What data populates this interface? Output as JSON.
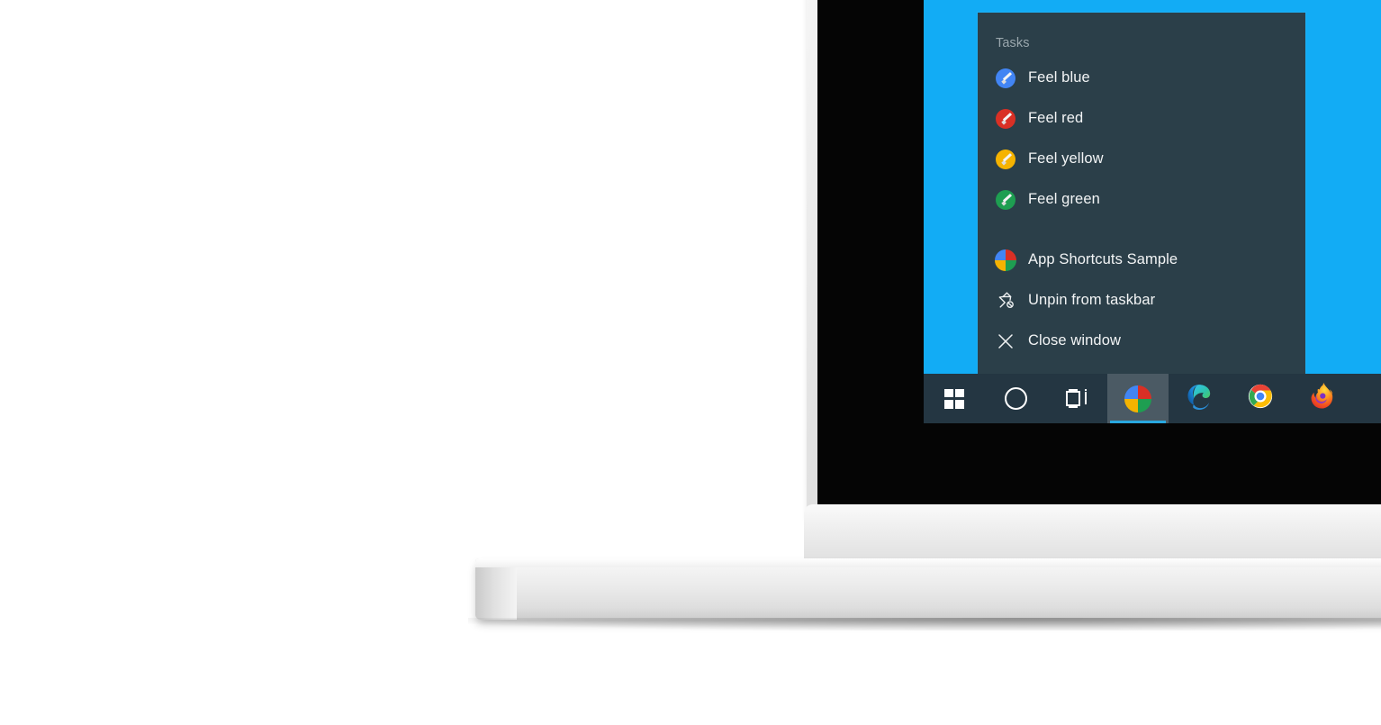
{
  "desktop": {
    "wallpaper_color": "#12acf5"
  },
  "jumplist": {
    "header": "Tasks",
    "background_color": "#2b3f49",
    "tasks": [
      {
        "label": "Feel blue",
        "icon": "pencil-circle-icon",
        "color": "#4285f4"
      },
      {
        "label": "Feel red",
        "icon": "pencil-circle-icon",
        "color": "#d93025"
      },
      {
        "label": "Feel yellow",
        "icon": "pencil-circle-icon",
        "color": "#f5b300"
      },
      {
        "label": "Feel green",
        "icon": "pencil-circle-icon",
        "color": "#1e9e51"
      }
    ],
    "actions": [
      {
        "label": "App Shortcuts Sample",
        "icon": "app-pie-icon"
      },
      {
        "label": "Unpin from taskbar",
        "icon": "unpin-icon"
      },
      {
        "label": "Close window",
        "icon": "close-x-icon"
      }
    ]
  },
  "taskbar": {
    "background_color": "#243642",
    "accent_color": "#29a8e0",
    "buttons": [
      {
        "name": "start",
        "icon": "windows-logo-icon",
        "active": false
      },
      {
        "name": "cortana",
        "icon": "cortana-circle-icon",
        "active": false
      },
      {
        "name": "task-view",
        "icon": "task-view-icon",
        "active": false
      },
      {
        "name": "app-shortcuts",
        "icon": "app-pie-icon",
        "active": true
      },
      {
        "name": "microsoft-edge",
        "icon": "edge-icon",
        "active": false
      },
      {
        "name": "google-chrome",
        "icon": "chrome-icon",
        "active": false
      },
      {
        "name": "mozilla-firefox",
        "icon": "firefox-icon",
        "active": false
      }
    ]
  }
}
